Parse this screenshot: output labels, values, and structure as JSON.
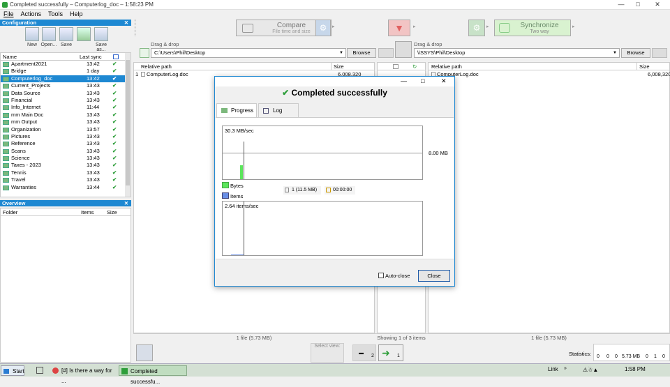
{
  "window": {
    "title": "Completed successfully – Computerlog_doc – 1:58:23 PM"
  },
  "menu": {
    "file": "File",
    "actions": "Actions",
    "tools": "Tools",
    "help": "Help"
  },
  "config_panel": {
    "title": "Configuration",
    "tools": {
      "new": "New",
      "open": "Open...",
      "save": "Save",
      "save_as": "Save as..."
    },
    "col_name": "Name",
    "col_last_sync": "Last sync",
    "items": [
      {
        "name": "Apartment2021",
        "last_sync": "13:42"
      },
      {
        "name": "Bridge",
        "last_sync": "1 day"
      },
      {
        "name": "Computerlog_doc",
        "last_sync": "13:42"
      },
      {
        "name": "Current_Projects",
        "last_sync": "13:43"
      },
      {
        "name": "Data Source",
        "last_sync": "13:43"
      },
      {
        "name": "Financial",
        "last_sync": "13:43"
      },
      {
        "name": "Info_Internet",
        "last_sync": "11:44"
      },
      {
        "name": "mm Main Doc",
        "last_sync": "13:43"
      },
      {
        "name": "mm Output",
        "last_sync": "13:43"
      },
      {
        "name": "Organization",
        "last_sync": "13:57"
      },
      {
        "name": "Pictures",
        "last_sync": "13:43"
      },
      {
        "name": "Reference",
        "last_sync": "13:43"
      },
      {
        "name": "Scans",
        "last_sync": "13:43"
      },
      {
        "name": "Science",
        "last_sync": "13:43"
      },
      {
        "name": "Taxes - 2023",
        "last_sync": "13:43"
      },
      {
        "name": "Tennis",
        "last_sync": "13:43"
      },
      {
        "name": "Travel",
        "last_sync": "13:43"
      },
      {
        "name": "Warranties",
        "last_sync": "13:44"
      }
    ],
    "selected_index": 2
  },
  "overview_panel": {
    "title": "Overview",
    "col_folder": "Folder",
    "col_items": "Items",
    "col_size": "Size"
  },
  "toolbar": {
    "compare_label": "Compare",
    "compare_sub": "File time and size",
    "sync_label": "Synchronize",
    "sync_sub": "Two way"
  },
  "left_folder": {
    "drag_drop": "Drag & drop",
    "path": "C:\\Users\\Phil\\Desktop",
    "browse": "Browse"
  },
  "right_folder": {
    "drag_drop": "Drag & drop",
    "path": "\\\\SSYS\\Phil\\Desktop",
    "browse": "Browse"
  },
  "grid": {
    "col_relative_path": "Relative path",
    "col_size": "Size",
    "left_row": {
      "num": "1",
      "name": "ComputerLog.doc",
      "size": "6,008,320"
    },
    "right_row": {
      "name": "ComputerLog.doc",
      "size": "6,008,320"
    }
  },
  "status": {
    "left": "1 file (5.73 MB)",
    "middle": "Showing 1 of 3 items",
    "right": "1 file (5.73 MB)"
  },
  "bottom": {
    "select_view": "Select view:",
    "count_equal": "2",
    "count_sync": "1",
    "statistics": "Statistics:",
    "stats": [
      "0",
      "0",
      "0",
      "5.73 MB",
      "0",
      "1",
      "0"
    ]
  },
  "dialog": {
    "heading": "Completed successfully",
    "tab_progress": "Progress",
    "tab_log": "Log",
    "bytes_rate": "30.3 MB/sec",
    "bytes_scale": "8.00 MB",
    "legend_bytes": "Bytes",
    "legend_items": "Items",
    "items_processed": "1 (11.5 MB)",
    "time_elapsed": "00:00:00",
    "items_rate": "2.64 items/sec",
    "auto_close": "Auto-close",
    "close": "Close",
    "colors": {
      "bytes": "#5ce65c",
      "items": "#6a8fe6"
    }
  },
  "taskbar": {
    "start": "Start",
    "task1": "[#] Is there a way for ...",
    "task2": "Completed successfu...",
    "link": "Link",
    "clock": "1:58 PM"
  }
}
